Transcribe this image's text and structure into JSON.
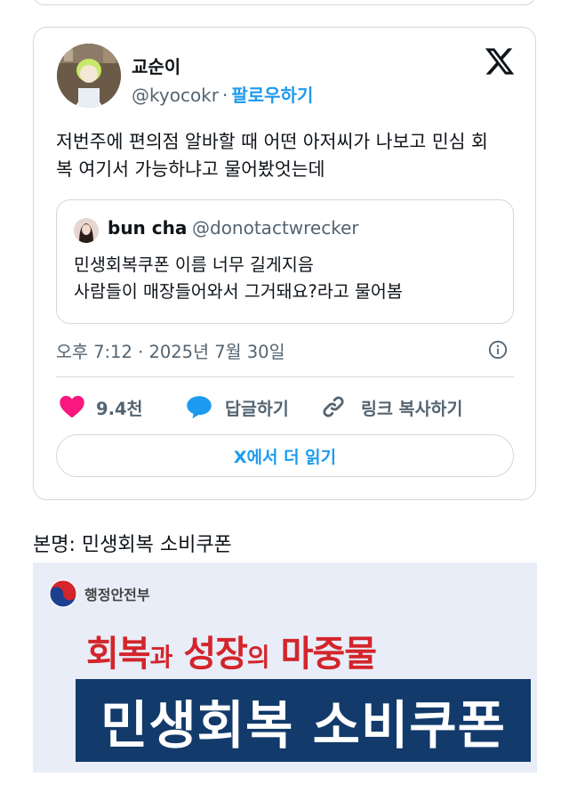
{
  "tweet": {
    "author": {
      "display_name": "교순이",
      "handle": "@kyocokr",
      "separator": "·",
      "follow_label": "팔로우하기"
    },
    "text_lines": [
      "저번주에 편의점 알바할 때 어떤 아저씨가 나보고 민심 회",
      "복 여기서 가능하냐고 물어봤엇는데"
    ],
    "quote": {
      "display_name": "bun cha",
      "handle": "@donotactwrecker",
      "text_lines": [
        "민생회복쿠폰 이름 너무 길게지음",
        "사람들이 매장들어와서 그거돼요?라고 물어봄"
      ]
    },
    "timestamp": "오후 7:12 · 2025년 7월 30일",
    "actions": {
      "like_count": "9.4천",
      "reply_label": "답글하기",
      "copy_link_label": "링크 복사하기"
    },
    "read_more_label": "X에서 더 읽기"
  },
  "caption": "본명: 민생회복 소비쿠폰",
  "banner": {
    "ministry": "행정안전부",
    "slogan_part1": "회복",
    "slogan_connector1": "과",
    "slogan_part2": "성장",
    "slogan_connector2": "의",
    "slogan_part3": "마중물",
    "coupon_title": "민생회복 소비쿠폰"
  },
  "colors": {
    "like": "#f91880",
    "reply": "#1d9bf0",
    "link": "#1d9bf0",
    "slogan_red": "#d3252b",
    "coupon_navy": "#123a6b",
    "banner_bg": "#e8edf8"
  }
}
